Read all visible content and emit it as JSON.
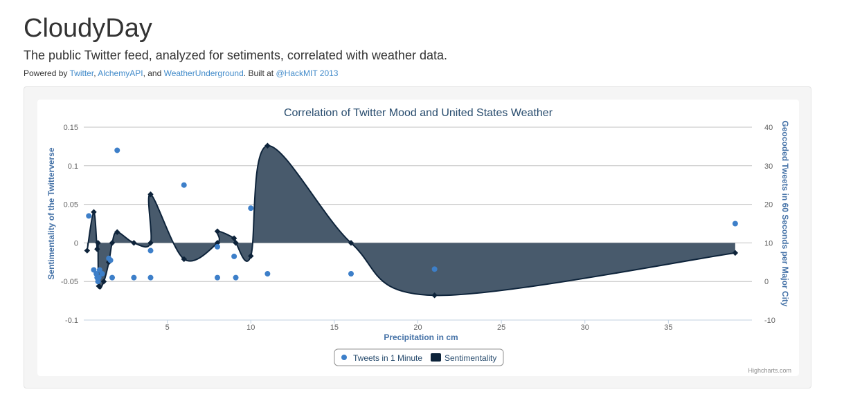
{
  "header": {
    "title": "CloudyDay",
    "lead": "The public Twitter feed, analyzed for setiments, correlated with weather data.",
    "powered_prefix": "Powered by ",
    "link_twitter": "Twitter",
    "sep1": ", ",
    "link_alchemy": "AlchemyAPI",
    "sep2": ", and ",
    "link_wu": "WeatherUnderground",
    "built_at": ". Built at ",
    "link_hackmit": "@HackMIT 2013"
  },
  "colors": {
    "link": "#428bca",
    "tweets": "#3d7fc9",
    "sentiment_line": "#0d233a",
    "sentiment_fill": "#485a6c",
    "axis_label": "#4572a7"
  },
  "chart_data": {
    "type": "scatter+area",
    "title": "Correlation of Twitter Mood and United States Weather",
    "xlabel": "Precipitation in cm",
    "ylabel_left": "Sentimentality of the Twitterverse",
    "ylabel_right": "Geocoded Tweets in 60 Seconds per Major City",
    "xlim": [
      0,
      40
    ],
    "ylim_left": [
      -0.1,
      0.15
    ],
    "ylim_right": [
      -10,
      40
    ],
    "x_ticks": [
      "5",
      "10",
      "15",
      "20",
      "25",
      "30",
      "35"
    ],
    "y_left_ticks": [
      "0.15",
      "0.1",
      "0.05",
      "0",
      "-0.05",
      "-0.1"
    ],
    "y_right_ticks": [
      "40",
      "30",
      "20",
      "10",
      "0",
      "-10"
    ],
    "grid": true,
    "legend_position": "bottom-center",
    "credits": "Highcharts.com",
    "series": [
      {
        "name": "Tweets in 1 Minute",
        "type": "scatter",
        "axis": "right",
        "points": [
          [
            0.3,
            17
          ],
          [
            0.6,
            3
          ],
          [
            0.75,
            2
          ],
          [
            0.8,
            1
          ],
          [
            0.85,
            0
          ],
          [
            0.9,
            1
          ],
          [
            0.95,
            3
          ],
          [
            1.1,
            2
          ],
          [
            1.5,
            6
          ],
          [
            1.6,
            5.5
          ],
          [
            1.7,
            1
          ],
          [
            2.0,
            34
          ],
          [
            3.0,
            1
          ],
          [
            4.0,
            8
          ],
          [
            4.0,
            1
          ],
          [
            6.0,
            25
          ],
          [
            8.0,
            1
          ],
          [
            8.0,
            9
          ],
          [
            9.0,
            6.5
          ],
          [
            9.1,
            1
          ],
          [
            10.0,
            19
          ],
          [
            11.0,
            2
          ],
          [
            16.0,
            2
          ],
          [
            21.0,
            3.2
          ],
          [
            39.0,
            15
          ]
        ]
      },
      {
        "name": "Sentimentality",
        "type": "areaspline",
        "axis": "left",
        "points": [
          [
            0.2,
            -0.01
          ],
          [
            0.6,
            0.04
          ],
          [
            0.8,
            -0.008
          ],
          [
            0.85,
            0.0
          ],
          [
            0.9,
            -0.056
          ],
          [
            1.2,
            -0.05
          ],
          [
            1.5,
            -0.025
          ],
          [
            1.7,
            0.0
          ],
          [
            2.0,
            0.014
          ],
          [
            3.0,
            0.0
          ],
          [
            4.0,
            0.0
          ],
          [
            4.0,
            0.063
          ],
          [
            6.0,
            -0.021
          ],
          [
            8.0,
            0.0
          ],
          [
            8.0,
            0.015
          ],
          [
            9.0,
            0.006
          ],
          [
            9.1,
            0.0
          ],
          [
            10.0,
            -0.017
          ],
          [
            11.0,
            0.126
          ],
          [
            16.0,
            0.0
          ],
          [
            21.0,
            -0.068
          ],
          [
            39.0,
            -0.013
          ]
        ]
      }
    ]
  }
}
